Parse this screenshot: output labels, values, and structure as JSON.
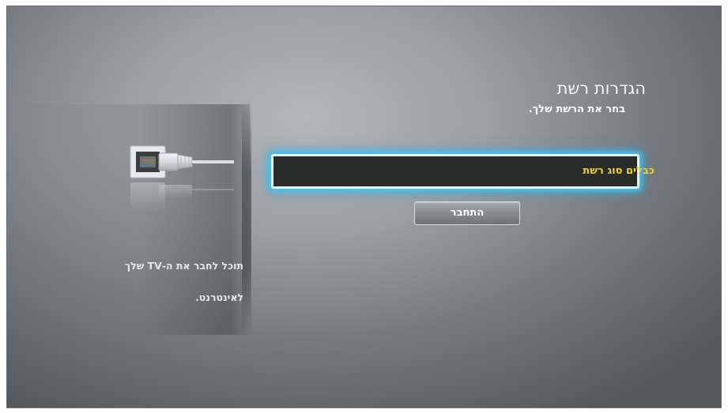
{
  "header": {
    "title": "הגדרות רשת",
    "subtitle": "בחר את הרשת שלך."
  },
  "network_field": {
    "value": "כבלים סוג רשת"
  },
  "connect_button": {
    "label": "התחבר"
  },
  "side_panel": {
    "icon": "ethernet-cable-icon",
    "info_line1": "תוכל לחבר את ה-TV שלך",
    "info_line2": "לאינטרנט."
  },
  "colors": {
    "focus_glow": "#44c6f0",
    "value_text": "#f0d21c",
    "field_bg": "#2a2b2b"
  }
}
